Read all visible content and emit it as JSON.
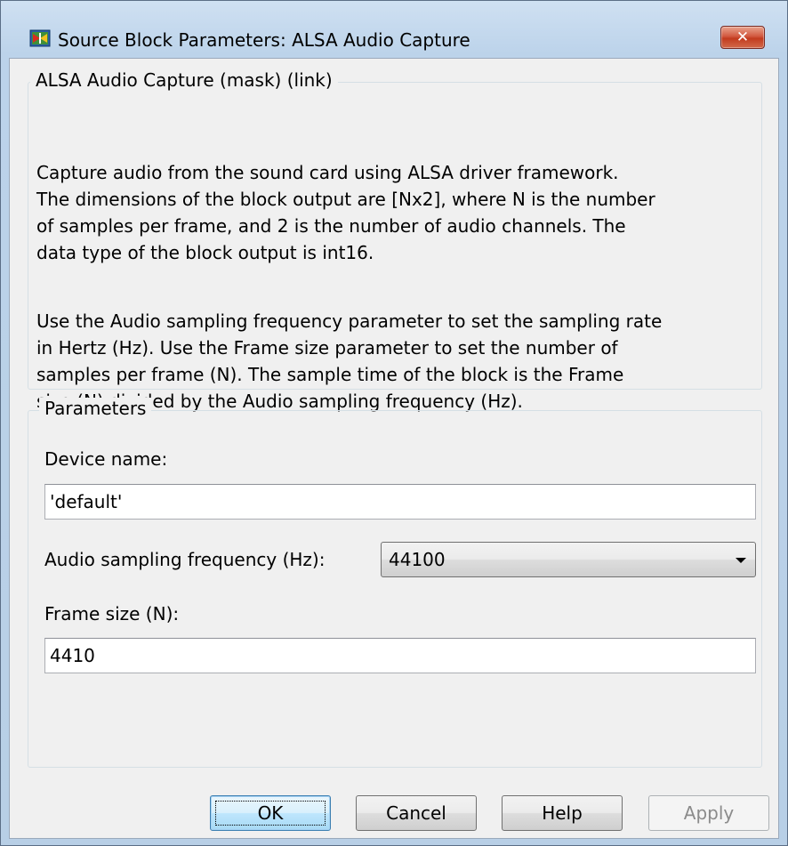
{
  "window": {
    "title": "Source Block Parameters: ALSA Audio Capture",
    "close_label": "✕",
    "icon": "simulink-block-icon"
  },
  "description_group": {
    "legend": "ALSA Audio Capture (mask) (link)",
    "paragraphs": [
      [
        "Capture audio from the sound card using ALSA driver framework.",
        "The dimensions of the block output are [Nx2], where N is the number",
        "of samples per frame, and 2 is the number of audio channels. The",
        "data type of the block output is int16."
      ],
      [
        "Use the Audio sampling frequency parameter to set the sampling rate",
        "in Hertz (Hz). Use the Frame size parameter to set the number of",
        "samples per frame (N). The sample time of the block is the Frame",
        "size (N) divided by the Audio sampling frequency (Hz)."
      ]
    ]
  },
  "parameters_group": {
    "legend": "Parameters",
    "device_name": {
      "label": "Device name:",
      "value": "'default'"
    },
    "sampling_frequency": {
      "label": "Audio sampling frequency (Hz):",
      "value": "44100"
    },
    "frame_size": {
      "label": "Frame size (N):",
      "value": "4410"
    }
  },
  "buttons": {
    "ok": "OK",
    "cancel": "Cancel",
    "help": "Help",
    "apply": "Apply"
  }
}
